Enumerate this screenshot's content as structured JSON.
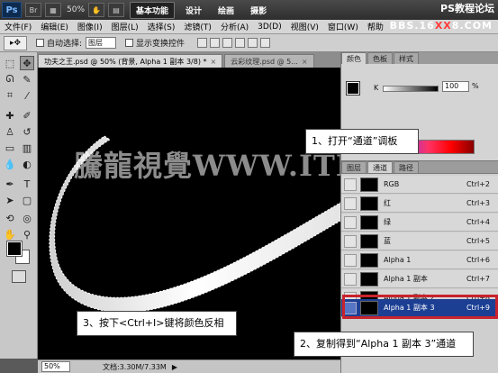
{
  "titlebar": {
    "logo": "Ps",
    "zoom": "50%",
    "workspaces": [
      "基本功能",
      "设计",
      "绘画",
      "摄影"
    ],
    "watermark": "PS教程论坛"
  },
  "menubar": {
    "items": [
      "文件(F)",
      "编辑(E)",
      "图像(I)",
      "图层(L)",
      "选择(S)",
      "滤镜(T)",
      "分析(A)",
      "3D(D)",
      "视图(V)",
      "窗口(W)",
      "帮助"
    ],
    "watermark_prefix": "BBS.16",
    "watermark_xx": "XX",
    "watermark_suffix": "8.COM"
  },
  "optbar": {
    "auto_select_label": "自动选择:",
    "auto_select_value": "图层",
    "show_transform_label": "显示变换控件"
  },
  "document": {
    "tabs": [
      {
        "label": "功夫之王.psd @ 50% (背景, Alpha 1 副本 3/8) *",
        "close": "×"
      },
      {
        "label": "云彩纹理.psd @ 5...",
        "close": "×"
      }
    ],
    "canvas_watermark": "騰龍視覺WWW.ITDST"
  },
  "statusbar": {
    "zoom": "50%",
    "doc_info": "文档:3.30M/7.33M",
    "arrow": "▶"
  },
  "color_panel": {
    "tabs": [
      "颜色",
      "色板",
      "样式"
    ],
    "k_label": "K",
    "k_value": "100",
    "k_unit": "%"
  },
  "channels_panel": {
    "tabs": [
      "图层",
      "通道",
      "路径"
    ],
    "rows": [
      {
        "name": "RGB",
        "shortcut": "Ctrl+2"
      },
      {
        "name": "红",
        "shortcut": "Ctrl+3"
      },
      {
        "name": "绿",
        "shortcut": "Ctrl+4"
      },
      {
        "name": "蓝",
        "shortcut": "Ctrl+5"
      },
      {
        "name": "Alpha 1",
        "shortcut": "Ctrl+6"
      },
      {
        "name": "Alpha 1 副本",
        "shortcut": "Ctrl+7"
      },
      {
        "name": "Alpha 1 副本 2",
        "shortcut": "Ctrl+8"
      },
      {
        "name": "Alpha 1 副本 3",
        "shortcut": "Ctrl+9"
      }
    ]
  },
  "callouts": {
    "step1": "1、打开“通道”调板",
    "step2": "2、复制得到“Alpha 1 副本 3”通道",
    "step3": "3、按下<Ctrl+I>键将颜色反相"
  },
  "colors": {
    "selected_row": "#1c3f94",
    "highlight_border": "#c8232c"
  }
}
